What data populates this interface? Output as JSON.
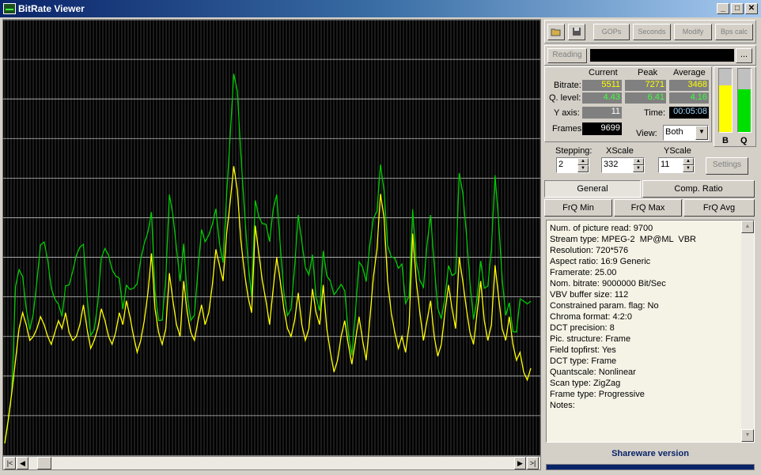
{
  "window": {
    "title": "BitRate Viewer",
    "minimize": "_",
    "maximize": "□",
    "close": "✕"
  },
  "toolbar": {
    "open_icon": "folder-open-icon",
    "save_icon": "floppy-disk-icon",
    "gops": "GOPs",
    "seconds": "Seconds",
    "modify": "Modify",
    "bps_calc": "Bps calc"
  },
  "reading": {
    "button": "Reading",
    "path_value": "",
    "browse": "..."
  },
  "stats": {
    "col_current": "Current",
    "col_peak": "Peak",
    "col_average": "Average",
    "bitrate_label": "Bitrate:",
    "bitrate_current": "5511",
    "bitrate_peak": "7271",
    "bitrate_average": "3468",
    "qlevel_label": "Q. level:",
    "qlevel_current": "4.43",
    "qlevel_peak": "6.41",
    "qlevel_average": "4.16",
    "yaxis_label": "Y axis:",
    "yaxis_value": "11",
    "time_label": "Time:",
    "time_value": "00:05:08",
    "frames_label": "Frames:",
    "frames_value": "9699",
    "view_label": "View:",
    "view_value": "Both"
  },
  "meters": {
    "b_label": "B",
    "q_label": "Q",
    "b_level": 0.74,
    "q_level": 0.67,
    "b_color": "#ffff00",
    "q_color": "#00e000"
  },
  "controls": {
    "stepping_label": "Stepping:",
    "stepping_value": "2",
    "xscale_label": "XScale",
    "xscale_value": "332",
    "yscale_label": "YScale",
    "yscale_value": "11",
    "settings": "Settings"
  },
  "tabs": {
    "general": "General",
    "comp_ratio": "Comp. Ratio",
    "frq_min": "FrQ Min",
    "frq_max": "FrQ Max",
    "frq_avg": "FrQ Avg"
  },
  "info_lines": [
    "Num. of picture read: 9700",
    "Stream type: MPEG-2  MP@ML  VBR",
    "Resolution: 720*576",
    "Aspect ratio: 16:9 Generic",
    "Framerate: 25.00",
    "Nom. bitrate: 9000000 Bit/Sec",
    "VBV buffer size: 112",
    "Constrained param. flag: No",
    "Chroma format: 4:2:0",
    "DCT precision: 8",
    "Pic. structure: Frame",
    "Field topfirst: Yes",
    "DCT type: Frame",
    "Quantscale: Nonlinear",
    "Scan type: ZigZag",
    "Frame type: Progressive",
    "Notes:"
  ],
  "footer": {
    "shareware": "Shareware version"
  },
  "graph": {
    "background": "#000000",
    "grid_color": "#808080",
    "bitrate_color": "#ffff00",
    "quant_color": "#00cc00",
    "y_max": 11,
    "bitrate_samples": [
      0.3,
      0.9,
      1.6,
      2.4,
      3.2,
      3.6,
      3.3,
      2.9,
      3.0,
      3.2,
      3.5,
      3.3,
      3.0,
      2.8,
      3.1,
      3.4,
      3.2,
      3.6,
      3.1,
      2.9,
      3.0,
      3.3,
      3.8,
      3.2,
      2.7,
      2.9,
      3.2,
      3.7,
      3.4,
      3.0,
      2.8,
      3.1,
      3.6,
      3.3,
      3.9,
      3.5,
      3.0,
      2.6,
      2.9,
      3.4,
      4.1,
      5.1,
      3.7,
      3.1,
      2.8,
      3.2,
      4.6,
      3.9,
      3.3,
      3.0,
      4.4,
      3.6,
      3.1,
      2.9,
      3.4,
      3.8,
      3.3,
      3.6,
      4.3,
      5.2,
      4.8,
      4.4,
      5.6,
      6.4,
      7.3,
      6.7,
      5.4,
      4.6,
      4.0,
      3.6,
      5.8,
      5.1,
      4.4,
      3.9,
      3.3,
      4.2,
      5.0,
      4.4,
      3.7,
      3.2,
      3.0,
      3.4,
      4.1,
      3.3,
      2.9,
      3.2,
      4.2,
      3.6,
      3.3,
      4.3,
      3.2,
      2.6,
      2.1,
      2.4,
      3.0,
      3.4,
      2.8,
      2.3,
      2.9,
      3.5,
      2.9,
      2.4,
      3.4,
      4.5,
      5.2,
      6.6,
      6.0,
      4.4,
      3.6,
      3.1,
      2.7,
      3.0,
      2.6,
      3.3,
      5.6,
      4.4,
      3.6,
      2.9,
      3.4,
      3.9,
      3.0,
      2.5,
      2.8,
      3.6,
      4.3,
      3.7,
      3.2,
      5.0,
      4.4,
      3.7,
      3.1,
      2.8,
      3.6,
      4.4,
      3.4,
      2.9,
      3.3,
      4.8,
      4.0,
      3.2,
      2.9,
      3.5,
      2.8,
      2.4,
      2.6,
      2.1,
      1.9,
      2.2
    ]
  }
}
